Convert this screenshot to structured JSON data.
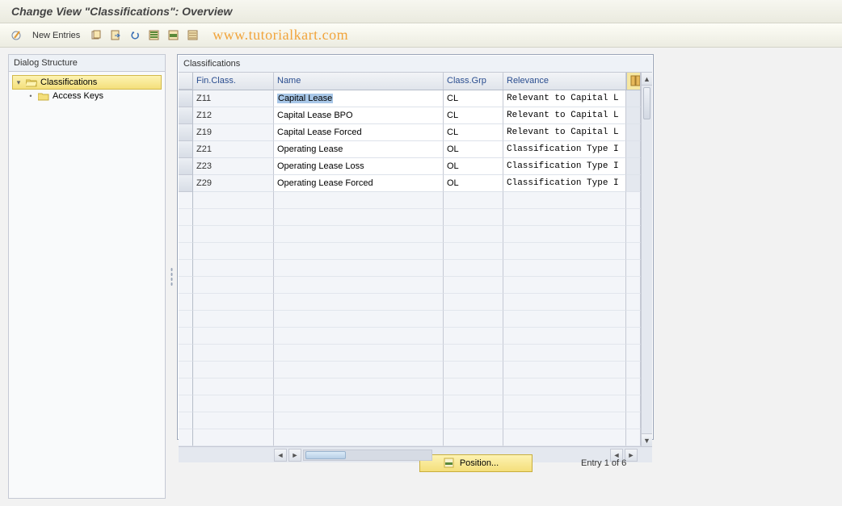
{
  "title": "Change View \"Classifications\": Overview",
  "toolbar": {
    "new_entries_label": "New Entries",
    "watermark": "www.tutorialkart.com"
  },
  "sidebar": {
    "title": "Dialog Structure",
    "items": [
      {
        "label": "Classifications",
        "selected": true,
        "expanded": true
      },
      {
        "label": "Access Keys",
        "selected": false,
        "expanded": false
      }
    ]
  },
  "panel": {
    "title": "Classifications",
    "columns": {
      "fin": "Fin.Class.",
      "name": "Name",
      "grp": "Class.Grp",
      "rel": "Relevance"
    },
    "rows": [
      {
        "fin": "Z11",
        "name": "Capital Lease",
        "grp": "CL",
        "rel": "Relevant to Capital L",
        "name_selected": true
      },
      {
        "fin": "Z12",
        "name": "Capital Lease BPO",
        "grp": "CL",
        "rel": "Relevant to Capital L"
      },
      {
        "fin": "Z19",
        "name": "Capital Lease Forced",
        "grp": "CL",
        "rel": "Relevant to Capital L"
      },
      {
        "fin": "Z21",
        "name": "Operating Lease",
        "grp": "OL",
        "rel": "Classification Type I"
      },
      {
        "fin": "Z23",
        "name": "Operating Lease Loss",
        "grp": "OL",
        "rel": "Classification Type I"
      },
      {
        "fin": "Z29",
        "name": "Operating Lease Forced",
        "grp": "OL",
        "rel": "Classification Type I"
      }
    ],
    "empty_rows": 15
  },
  "footer": {
    "position_label": "Position...",
    "entry_text": "Entry 1 of 6"
  }
}
